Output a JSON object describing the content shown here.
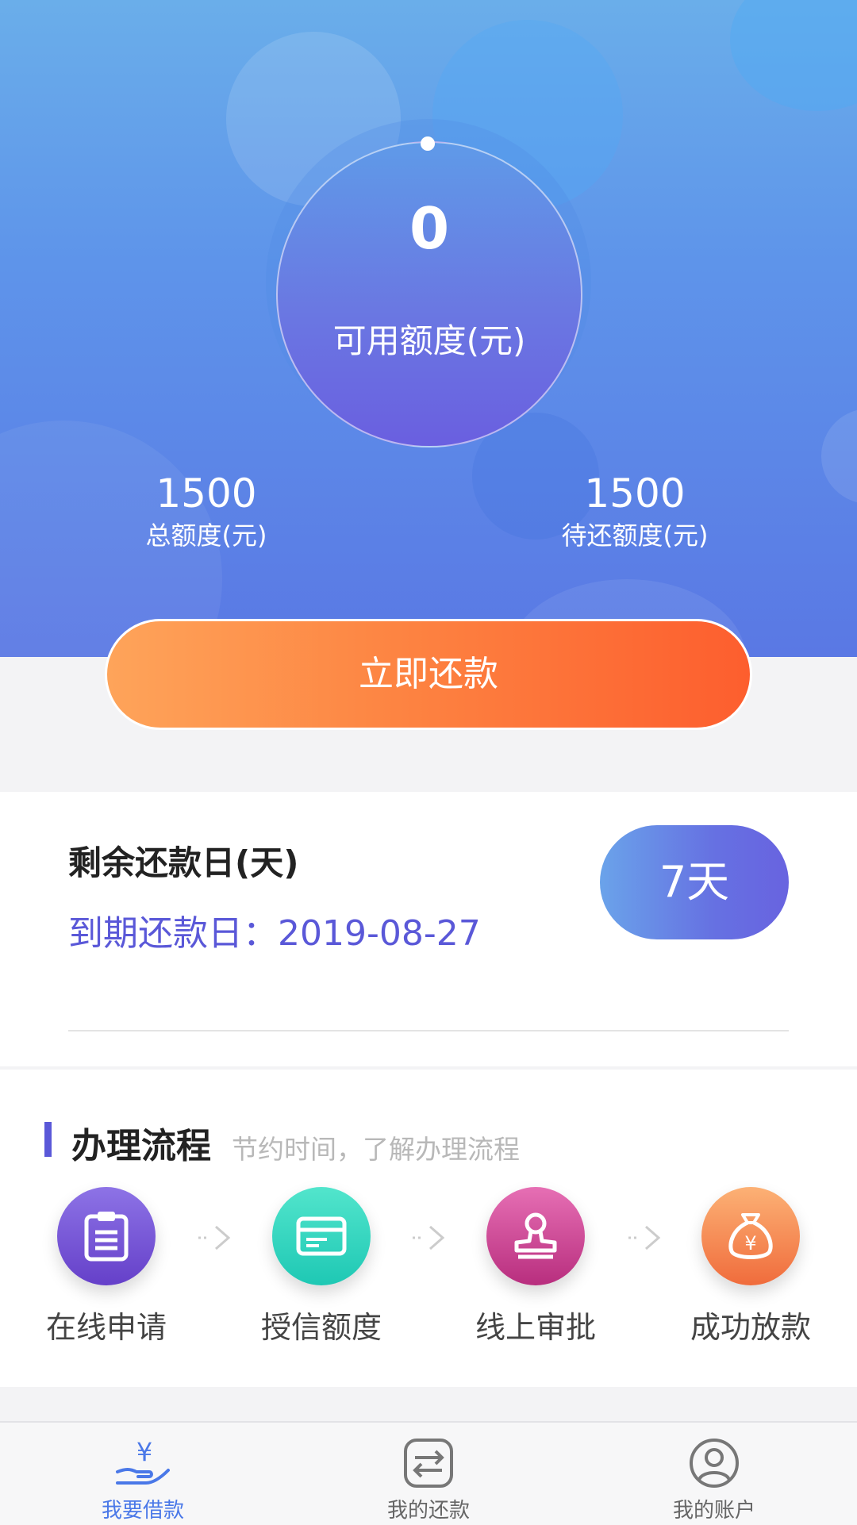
{
  "hero": {
    "available_value": "0",
    "available_label": "可用额度(元)",
    "total": {
      "value": "1500",
      "label": "总额度(元)"
    },
    "pending": {
      "value": "1500",
      "label": "待还额度(元)"
    },
    "repay_button": "立即还款"
  },
  "due": {
    "title": "剩余还款日(天)",
    "date_label": "到期还款日：",
    "date_value": "2019-08-27",
    "days": "7天"
  },
  "process": {
    "title": "办理流程",
    "subtitle": "节约时间，了解办理流程",
    "steps": [
      {
        "label": "在线申请",
        "icon": "clipboard-icon"
      },
      {
        "label": "授信额度",
        "icon": "card-icon"
      },
      {
        "label": "线上审批",
        "icon": "stamp-icon"
      },
      {
        "label": "成功放款",
        "icon": "money-bag-icon"
      }
    ]
  },
  "tabbar": {
    "tabs": [
      {
        "label": "我要借款",
        "icon": "loan-hand-icon",
        "active": true
      },
      {
        "label": "我的还款",
        "icon": "exchange-icon",
        "active": false
      },
      {
        "label": "我的账户",
        "icon": "user-icon",
        "active": false
      }
    ]
  },
  "colors": {
    "accent": "#5a58d8",
    "repay_button_start": "#fea45a",
    "repay_button_end": "#fd5e2e",
    "tab_active": "#4a78e8"
  }
}
